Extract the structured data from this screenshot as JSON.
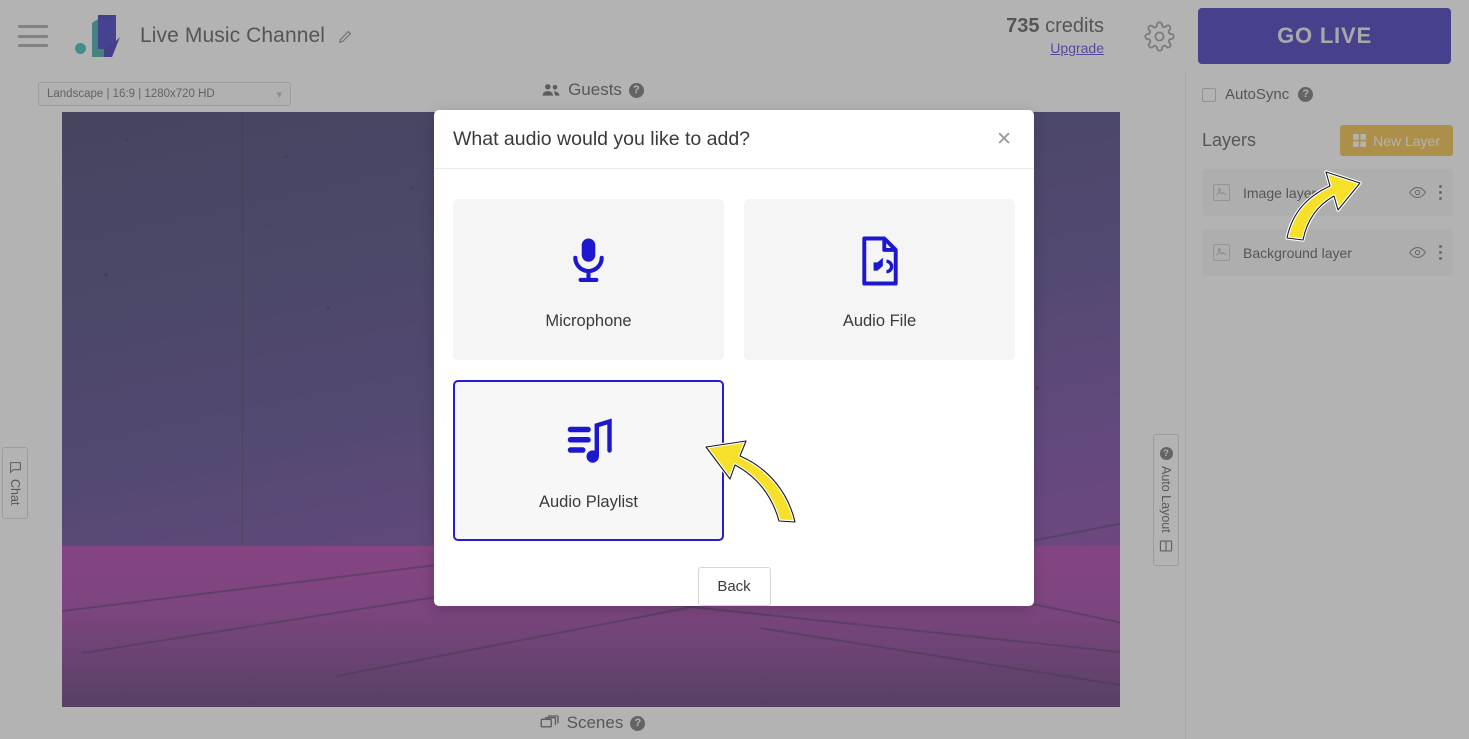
{
  "topbar": {
    "menu_icon": "hamburger-icon",
    "logo_icon": "brand-logo",
    "channel_title": "Live Music Channel",
    "edit_icon": "pencil-icon",
    "credits_value": "735",
    "credits_unit": " credits",
    "upgrade_label": "Upgrade",
    "settings_icon": "gear-icon",
    "go_live_label": "GO LIVE",
    "go_live_color": "#1d10b0"
  },
  "stage": {
    "format_value": "Landscape | 16:9 | 1280x720 HD",
    "format_caret": "chevron-down-icon",
    "guests_label": "Guests",
    "guests_icon": "people-icon",
    "guests_help": "?",
    "scenes_label": "Scenes",
    "scenes_icon": "screens-icon",
    "scenes_help": "?",
    "chat_tab_label": "Chat",
    "chat_tab_icon": "speech-bubble-icon",
    "auto_layout_label": "Auto Layout",
    "auto_layout_help": "?",
    "auto_layout_icon": "layout-grid-icon"
  },
  "right_panel": {
    "autosync_label": "AutoSync",
    "autosync_help": "?",
    "autosync_checked": false,
    "layers_title": "Layers",
    "new_layer_label": "New Layer",
    "new_layer_icon": "grid-add-icon",
    "new_layer_color": "#f0b323",
    "layers": [
      {
        "name": "Image layer",
        "thumb_icon": "image-icon",
        "visibility_icon": "eye-icon",
        "menu_icon": "more-vertical-icon"
      },
      {
        "name": "Background layer",
        "thumb_icon": "image-icon",
        "visibility_icon": "eye-icon",
        "menu_icon": "more-vertical-icon"
      }
    ]
  },
  "modal": {
    "title": "What audio would you like to add?",
    "close_icon": "close-icon",
    "options": [
      {
        "label": "Microphone",
        "icon": "microphone-icon",
        "selected": false
      },
      {
        "label": "Audio File",
        "icon": "audio-file-icon",
        "selected": false
      },
      {
        "label": "Audio Playlist",
        "icon": "audio-playlist-icon",
        "selected": true
      }
    ],
    "back_label": "Back",
    "accent_color": "#2a1ad6"
  },
  "annotations": {
    "arrow_color": "#f7e02a",
    "arrow_to_new_layer": "curved-arrow-icon",
    "arrow_to_audio_playlist": "curved-arrow-icon"
  }
}
